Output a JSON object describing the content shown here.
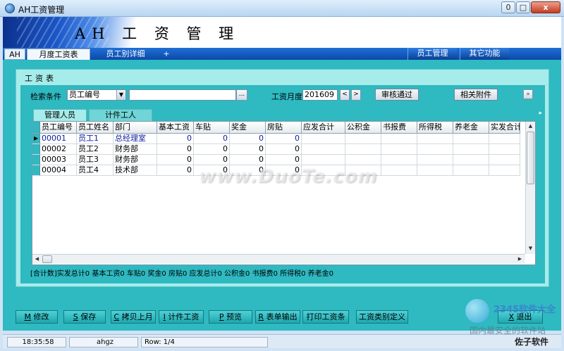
{
  "window": {
    "title": "AH工资管理",
    "min": "0",
    "max": "□",
    "close": "x"
  },
  "banner": {
    "title": "AH 工 资 管 理"
  },
  "tabs": {
    "ah": "AH",
    "monthly": "月度工资表",
    "detail": "员工别详细",
    "plus": "+",
    "employee_mgmt": "员工管理",
    "other": "其它功能"
  },
  "panel": {
    "title": "工资表"
  },
  "filter": {
    "label": "检索条件",
    "field_value": "员工编号",
    "search_value": "",
    "dots": "...",
    "month_label": "工资月度",
    "month_value": "201609",
    "prev": "<",
    "next": ">",
    "approve": "审核通过",
    "attachments": "相关附件",
    "collapse": "»"
  },
  "subtabs": {
    "managers": "管理人员",
    "piece_workers": "计件工人"
  },
  "grid": {
    "columns": [
      "员工编号",
      "员工姓名",
      "部门",
      "基本工资",
      "车贴",
      "奖金",
      "房贴",
      "应发合计",
      "公积金",
      "书报费",
      "所得税",
      "养老金",
      "实发合计"
    ],
    "rows": [
      {
        "id": "00001",
        "name": "员工1",
        "dept": "总经理室",
        "base": "0",
        "car": "0",
        "bonus": "0",
        "house": "0"
      },
      {
        "id": "00002",
        "name": "员工2",
        "dept": "财务部",
        "base": "0",
        "car": "0",
        "bonus": "0",
        "house": "0"
      },
      {
        "id": "00003",
        "name": "员工3",
        "dept": "财务部",
        "base": "0",
        "car": "0",
        "bonus": "0",
        "house": "0"
      },
      {
        "id": "00004",
        "name": "员工4",
        "dept": "技术部",
        "base": "0",
        "car": "0",
        "bonus": "0",
        "house": "0"
      }
    ]
  },
  "totals": "[合计数]实发总计0  基本工资0  车贴0  奖金0  房贴0  应发总计0  公积金0  书报费0  所得税0  养老金0",
  "buttons": {
    "modify_key": "M",
    "modify": " 修改",
    "save_key": "S",
    "save": " 保存",
    "copy_key": "C",
    "copy": " 拷贝上月",
    "piece_key": "I",
    "piece": " 计件工资",
    "preview_key": "P",
    "preview": " 预览",
    "export_key": "R",
    "export": " 表单输出",
    "print": "打印工资条",
    "category": "工资类别定义",
    "exit_key": "X",
    "exit": " 退出"
  },
  "status": {
    "time": "18:35:58",
    "user": "ahgz",
    "row": "Row: 1/4"
  },
  "watermark": "www.DuoTe.com",
  "corner_logo": {
    "brand": "2345软件大全",
    "slogan": "国内最安全的软件站",
    "vendor": "佐子软件"
  }
}
